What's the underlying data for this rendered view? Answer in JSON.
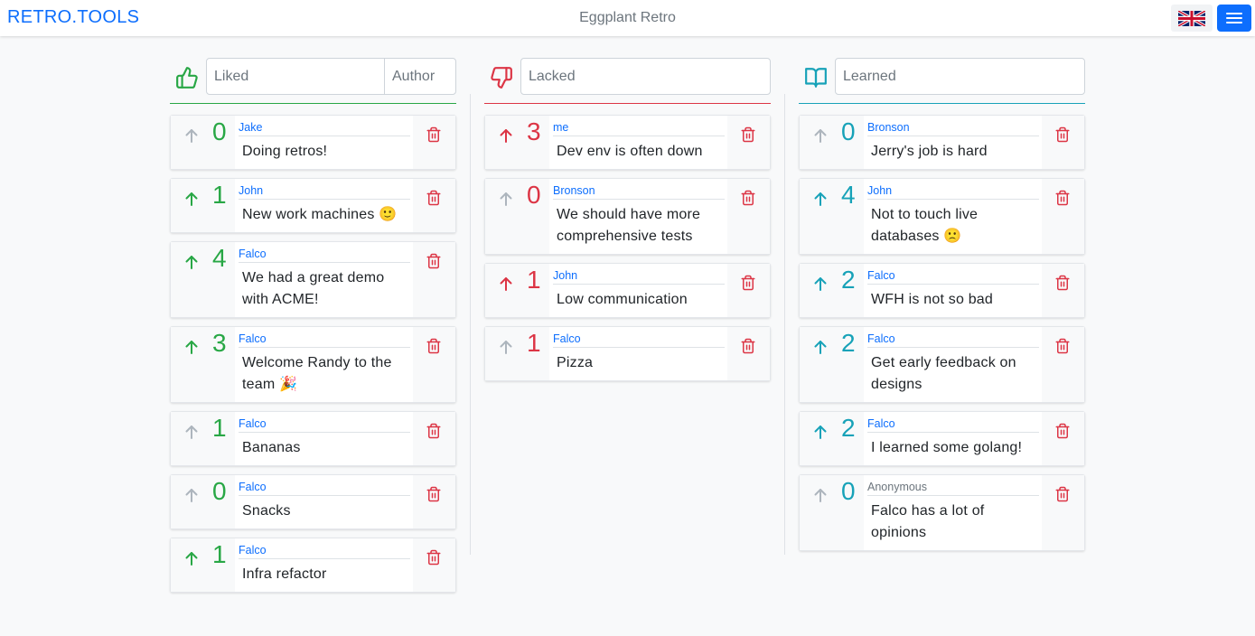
{
  "app": {
    "brand": "RETRO.TOOLS",
    "board_title": "Eggplant Retro"
  },
  "colors": {
    "liked": "#28a745",
    "lacked": "#dc3545",
    "learned": "#17a2b8",
    "brand": "#0d6efd",
    "muted": "#adb5bd"
  },
  "header": {
    "flag_icon": "uk-flag-icon",
    "menu_icon": "hamburger-menu-icon"
  },
  "columns": {
    "liked": {
      "icon": "thumbs-up-icon",
      "placeholder": "Liked",
      "author_placeholder": "Author",
      "cards": [
        {
          "author": "Jake",
          "text": "Doing retros!",
          "votes": "0",
          "voted": false
        },
        {
          "author": "John",
          "text": "New work machines 🙂",
          "votes": "1",
          "voted": true
        },
        {
          "author": "Falco",
          "text": "We had a great demo with ACME!",
          "votes": "4",
          "voted": true
        },
        {
          "author": "Falco",
          "text": "Welcome Randy to the team 🎉",
          "votes": "3",
          "voted": true
        },
        {
          "author": "Falco",
          "text": "Bananas",
          "votes": "1",
          "voted": false
        },
        {
          "author": "Falco",
          "text": "Snacks",
          "votes": "0",
          "voted": false
        },
        {
          "author": "Falco",
          "text": "Infra refactor",
          "votes": "1",
          "voted": true
        }
      ]
    },
    "lacked": {
      "icon": "thumbs-down-icon",
      "placeholder": "Lacked",
      "cards": [
        {
          "author": "me",
          "text": "Dev env is often down",
          "votes": "3",
          "voted": true
        },
        {
          "author": "Bronson",
          "text": "We should have more comprehensive tests",
          "votes": "0",
          "voted": false
        },
        {
          "author": "John",
          "text": "Low communication",
          "votes": "1",
          "voted": true
        },
        {
          "author": "Falco",
          "text": "Pizza",
          "votes": "1",
          "voted": false
        }
      ]
    },
    "learned": {
      "icon": "open-book-icon",
      "placeholder": "Learned",
      "cards": [
        {
          "author": "Bronson",
          "text": "Jerry's job is hard",
          "votes": "0",
          "voted": false
        },
        {
          "author": "John",
          "text": "Not to touch live databases 🙁",
          "votes": "4",
          "voted": true
        },
        {
          "author": "Falco",
          "text": "WFH is not so bad",
          "votes": "2",
          "voted": true
        },
        {
          "author": "Falco",
          "text": "Get early feedback on designs",
          "votes": "2",
          "voted": true
        },
        {
          "author": "Falco",
          "text": "I learned some golang!",
          "votes": "2",
          "voted": true
        },
        {
          "author": "Anonymous",
          "text": "Falco has a lot of opinions",
          "votes": "0",
          "voted": false,
          "anonymous": true
        }
      ]
    }
  }
}
